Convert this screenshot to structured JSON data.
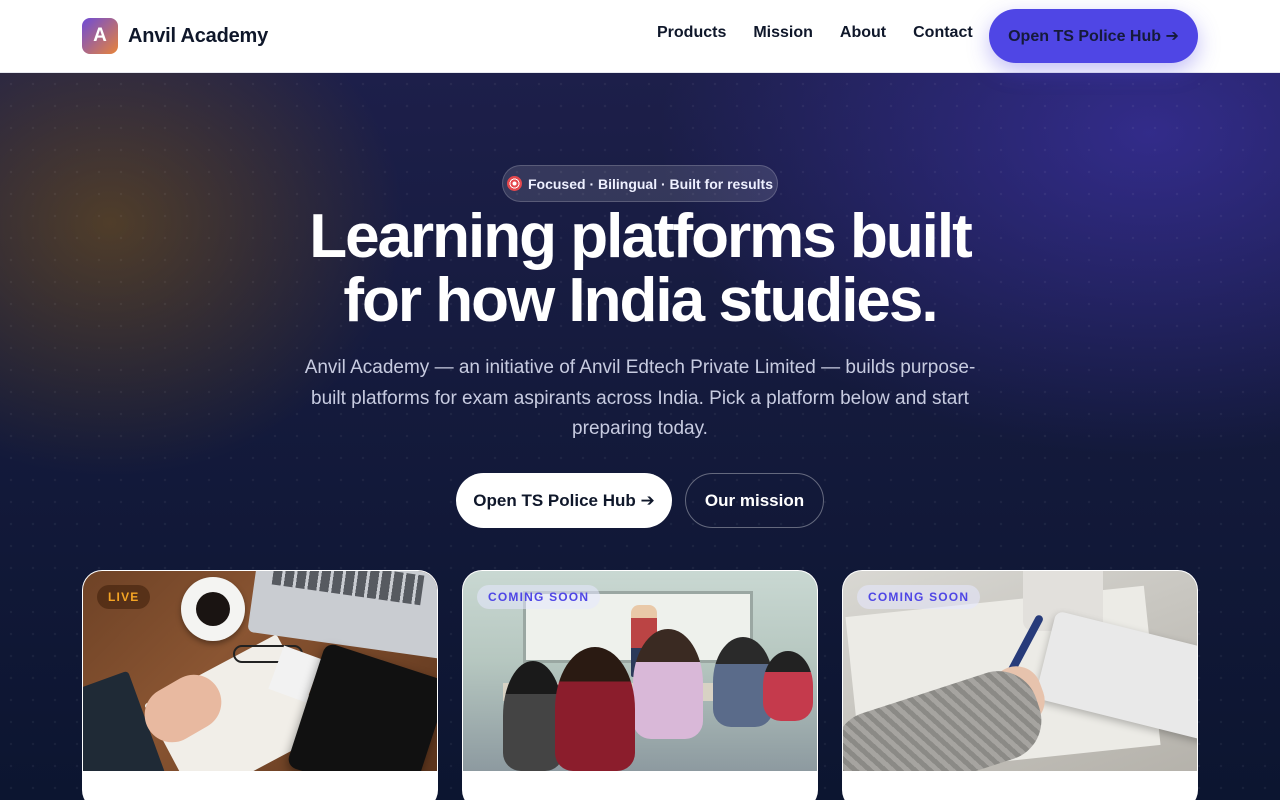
{
  "nav": {
    "brand_letter": "A",
    "brand_name": "Anvil Academy",
    "links": [
      "Products",
      "Mission",
      "About",
      "Contact"
    ],
    "cta_label": "Open TS Police Hub ➔"
  },
  "hero": {
    "pill_icon": "target-icon",
    "pill_text": "Focused · Bilingual · Built for results",
    "title_line1": "Learning platforms built",
    "title_line2": "for how India studies.",
    "subtitle": "Anvil Academy — an initiative of Anvil Edtech Private Limited — builds purpose-built platforms for exam aspirants across India. Pick a platform below and start preparing today.",
    "primary_button": "Open TS Police Hub ➔",
    "secondary_button": "Our mission"
  },
  "cards": [
    {
      "badge": "LIVE",
      "badge_status": "live",
      "photo": "desk-with-laptop-tablet-and-notebook"
    },
    {
      "badge": "COMING SOON",
      "badge_status": "soon",
      "photo": "classroom-with-students-and-teacher"
    },
    {
      "badge": "COMING SOON",
      "badge_status": "soon",
      "photo": "person-writing-on-paper"
    }
  ],
  "colors": {
    "accent": "#4f46e5",
    "live_badge": "#f5a524",
    "soon_badge": "#4f46e5",
    "hero_bg": "#141a3c"
  }
}
